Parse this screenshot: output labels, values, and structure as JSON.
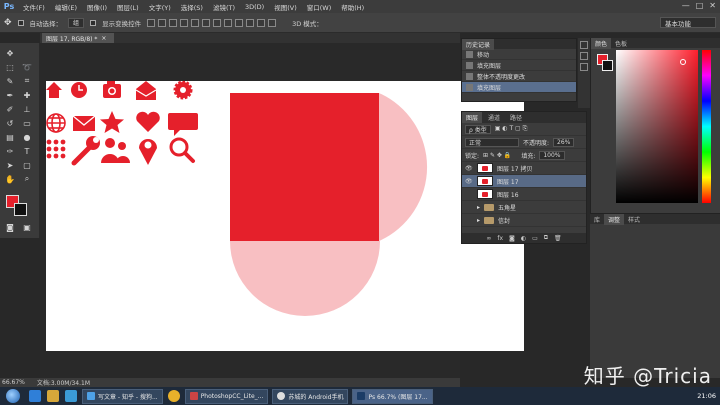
{
  "app": {
    "logo": "Ps"
  },
  "menu": [
    "文件(F)",
    "编辑(E)",
    "图像(I)",
    "图层(L)",
    "文字(Y)",
    "选择(S)",
    "滤镜(T)",
    "3D(D)",
    "视图(V)",
    "窗口(W)",
    "帮助(H)"
  ],
  "window_controls": [
    "—",
    "□",
    "✕"
  ],
  "options_bar": {
    "auto_select_label": "自动选择：",
    "auto_select_value": "组",
    "transform_label": "显示变换控件",
    "mode_3d_label": "3D 模式：",
    "workspace": "基本功能"
  },
  "document_tab": {
    "title": "图层 17, RGB/8) *",
    "close": "×"
  },
  "status": {
    "zoom": "66.67%",
    "doc": "文档:3.00M/34.1M"
  },
  "history_panel": {
    "tabs": [
      "历史记录"
    ],
    "rows": [
      "移动",
      "填充图层",
      "整体不透明度更改",
      "填充图层"
    ],
    "active_index": 3
  },
  "layers_panel": {
    "tabs": [
      "图层",
      "通道",
      "路径"
    ],
    "filter_label": "ρ 类型",
    "blend_mode": "正常",
    "opacity_label": "不透明度:",
    "opacity_value": "26%",
    "lock_label": "锁定:",
    "fill_label": "填充:",
    "fill_value": "100%",
    "layers": [
      {
        "name": "图层 17 拷贝",
        "type": "layer",
        "visible": true,
        "active": false
      },
      {
        "name": "图层 17",
        "type": "layer",
        "visible": true,
        "active": true
      },
      {
        "name": "图层 16",
        "type": "layer",
        "visible": false,
        "active": false
      },
      {
        "name": "五角星",
        "type": "group",
        "visible": false,
        "active": false
      },
      {
        "name": "信封",
        "type": "group",
        "visible": false,
        "active": false
      }
    ],
    "footer_icons": [
      "link-icon",
      "fx-icon",
      "mask-icon",
      "adjust-icon",
      "folder-icon",
      "new-layer-icon",
      "trash-icon"
    ]
  },
  "color_panel": {
    "tabs": [
      "颜色",
      "色板"
    ]
  },
  "adjust_panel": {
    "tabs": [
      "库",
      "调整",
      "样式"
    ]
  },
  "colors": {
    "brand_red": "#e5202b",
    "pale_red": "#f8bfc2"
  },
  "canvas_icons": [
    "home-icon",
    "clock-icon",
    "camera-icon",
    "mail-open-icon",
    "gear-icon",
    "globe-icon",
    "envelope-icon",
    "star-icon",
    "heart-icon",
    "chat-icon",
    "dots-grid-icon",
    "wrench-icon",
    "users-icon",
    "map-pin-icon",
    "search-icon"
  ],
  "watermark": "知乎 @Tricia",
  "taskbar": {
    "items": [
      {
        "label": "写文章 - 知乎 - 搜狗...",
        "active": false
      },
      {
        "label": "PhotoshopCC_Lite_...",
        "active": false
      },
      {
        "label": "苏城的 Android手机",
        "active": false
      },
      {
        "label": "Ps 66.7% (图层 17...",
        "active": true
      }
    ],
    "clock": "21:06"
  }
}
